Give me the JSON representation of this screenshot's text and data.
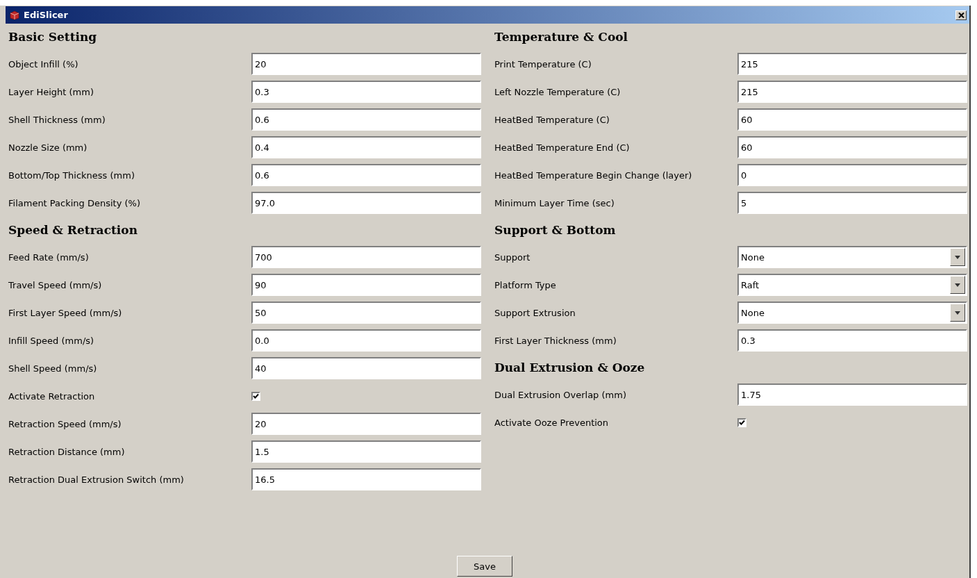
{
  "window": {
    "title": "EdiSlicer"
  },
  "columns": [
    {
      "sections": [
        {
          "title": "Basic Setting",
          "fields": [
            {
              "kind": "text",
              "label": "Object Infill (%)",
              "value": "20"
            },
            {
              "kind": "text",
              "label": "Layer Height (mm)",
              "value": "0.3"
            },
            {
              "kind": "text",
              "label": "Shell Thickness (mm)",
              "value": "0.6"
            },
            {
              "kind": "text",
              "label": "Nozzle Size (mm)",
              "value": "0.4"
            },
            {
              "kind": "text",
              "label": "Bottom/Top Thickness (mm)",
              "value": "0.6"
            },
            {
              "kind": "text",
              "label": "Filament Packing Density (%)",
              "value": "97.0"
            }
          ]
        },
        {
          "title": "Speed & Retraction",
          "fields": [
            {
              "kind": "text",
              "label": "Feed Rate (mm/s)",
              "value": "700"
            },
            {
              "kind": "text",
              "label": "Travel Speed (mm/s)",
              "value": "90"
            },
            {
              "kind": "text",
              "label": "First Layer Speed (mm/s)",
              "value": "50"
            },
            {
              "kind": "text",
              "label": "Infill Speed (mm/s)",
              "value": "0.0"
            },
            {
              "kind": "text",
              "label": "Shell Speed (mm/s)",
              "value": "40"
            },
            {
              "kind": "checkbox",
              "label": "Activate Retraction",
              "checked": true
            },
            {
              "kind": "text",
              "label": "Retraction Speed (mm/s)",
              "value": "20"
            },
            {
              "kind": "text",
              "label": "Retraction Distance (mm)",
              "value": "1.5"
            },
            {
              "kind": "text",
              "label": "Retraction Dual Extrusion Switch (mm)",
              "value": "16.5"
            }
          ]
        }
      ]
    },
    {
      "sections": [
        {
          "title": "Temperature & Cool",
          "fields": [
            {
              "kind": "text",
              "label": "Print Temperature (C)",
              "value": "215"
            },
            {
              "kind": "text",
              "label": "Left Nozzle Temperature (C)",
              "value": "215"
            },
            {
              "kind": "text",
              "label": "HeatBed Temperature (C)",
              "value": "60"
            },
            {
              "kind": "text",
              "label": "HeatBed Temperature End (C)",
              "value": "60"
            },
            {
              "kind": "text",
              "label": "HeatBed Temperature Begin Change (layer)",
              "value": "0"
            },
            {
              "kind": "text",
              "label": "Minimum Layer Time (sec)",
              "value": "5"
            }
          ]
        },
        {
          "title": "Support & Bottom",
          "fields": [
            {
              "kind": "select",
              "label": "Support",
              "value": "None"
            },
            {
              "kind": "select",
              "label": "Platform Type",
              "value": "Raft"
            },
            {
              "kind": "select",
              "label": "Support Extrusion",
              "value": "None"
            },
            {
              "kind": "text",
              "label": "First Layer Thickness (mm)",
              "value": "0.3"
            }
          ]
        },
        {
          "title": "Dual Extrusion & Ooze",
          "fields": [
            {
              "kind": "text",
              "label": "Dual Extrusion Overlap (mm)",
              "value": "1.75"
            },
            {
              "kind": "checkbox",
              "label": "Activate Ooze Prevention",
              "checked": true
            }
          ]
        }
      ]
    }
  ],
  "buttons": [
    "Save"
  ]
}
